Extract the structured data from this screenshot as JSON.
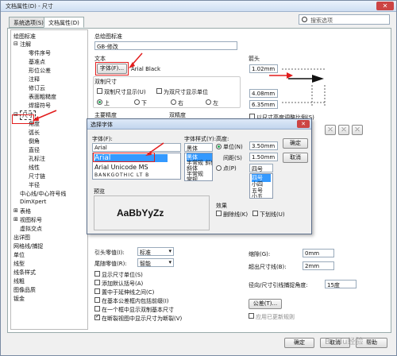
{
  "window": {
    "title": "文档属性(D) - 尺寸",
    "close_label": "✕"
  },
  "tabs": [
    {
      "label": "系统选项(S)"
    },
    {
      "label": "文档属性(D)"
    }
  ],
  "search": {
    "placeholder": "搜索选项"
  },
  "tree": {
    "items": [
      "绘图标准",
      "注解",
      "零件序号",
      "基准点",
      "形位公差",
      "注释",
      "修订云",
      "表面粗糙度",
      "焊接符号",
      "尺寸",
      "角度",
      "弧长",
      "倒角",
      "直径",
      "孔标注",
      "线性",
      "尺寸链",
      "半径",
      "中心线/中心符号线",
      "DimXpert",
      "表格",
      "视图标号",
      "虚拟交点",
      "出详图",
      "网格线/捕捉",
      "单位",
      "线型",
      "线条样式",
      "线粗",
      "图像品质",
      "钣金"
    ]
  },
  "main": {
    "standard_label": "总绘图标准",
    "standard_value": "GB-修改",
    "text_label": "文本",
    "font_button": "字体(F)...",
    "font_value": "Arial Black",
    "dual_label": "双制尺寸",
    "dual_show": "双制尺寸显示(U)",
    "dual_unit": "为双尺寸显示单位",
    "pos_top": "上",
    "pos_bottom": "下",
    "pos_right": "右",
    "pos_left": "左",
    "primary_precision": "主要精度",
    "dual_precision": "双精度",
    "arrow_label": "箭头",
    "arrow_v1": "1.02mm",
    "arrow_v2": "4.08mm",
    "arrow_v3": "6.35mm",
    "arrow_scale": "以尺寸高度调整比例(S)",
    "leader_zero": "引头零值(I):",
    "leader_zero_value": "标准",
    "trailing_zero": "尾随零值(R):",
    "trailing_zero_value": "智能",
    "opt1": "显示尺寸单位(S)",
    "opt2": "添加默认括号(A)",
    "opt3": "置中于延伸线之间(C)",
    "opt4": "在基本公差框内包括前缀(I)",
    "opt5": "在一个框中显示双制基本尺寸",
    "opt6": "在断裂视图中显示尺寸为断裂(V)",
    "gap_label": "缩隙(G):",
    "gap_value": "0mm",
    "over_label": "超出尺寸线(B):",
    "over_value": "2mm",
    "radial_label": "径向/尺寸引线捕捉角度:",
    "radial_value": "15度",
    "tolerance_button": "公差(T)...",
    "apply_update": "应用已更新规则"
  },
  "dialog": {
    "title": "选择字体",
    "font_label": "字体(F):",
    "font_input": "Arial",
    "fonts": [
      "Arial",
      "Arial Unicode MS",
      "BANKGOTHIC LT B"
    ],
    "style_label": "字体样式(Y):",
    "style_input": "黑体",
    "styles": [
      "黑体",
      "半常规 斜体",
      "斜体",
      "半常规",
      "常规"
    ],
    "height_label": "高度:",
    "unit_label": "单位(N)",
    "unit_value": "3.50mm",
    "spacing_label": "间距(S)",
    "spacing_value": "1.50mm",
    "point_label": "点(P)",
    "point_value": "四号",
    "points": [
      "四号",
      "小四",
      "五号",
      "小五"
    ],
    "ok": "确定",
    "cancel": "取消",
    "preview_label": "预览",
    "preview_text": "AaBbYyZz",
    "effects_label": "效果",
    "strike": "删除线(K)",
    "underline": "下划线(U)"
  },
  "footer": {
    "ok": "确定",
    "cancel": "取消",
    "help": "帮助"
  },
  "watermark": "Baidu经验",
  "colors": {
    "highlight": "#3399ff",
    "annotation": "#e21d1d"
  }
}
